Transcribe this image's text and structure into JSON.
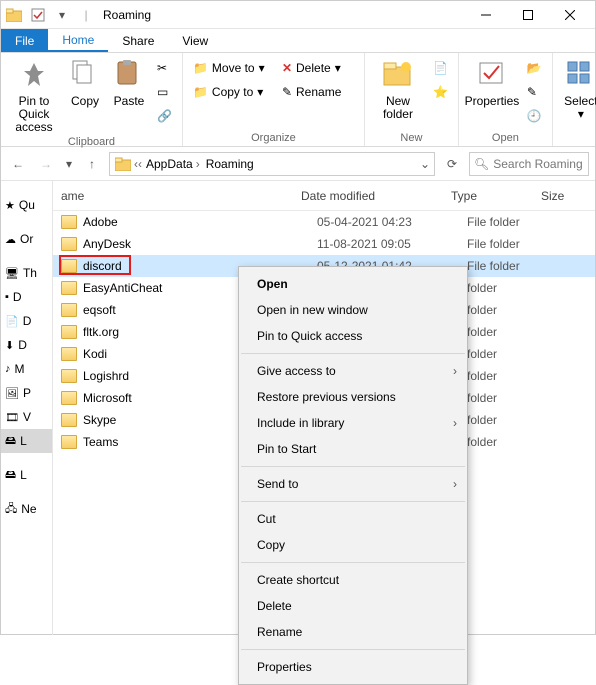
{
  "window": {
    "title": "Roaming"
  },
  "tabs": {
    "file": "File",
    "home": "Home",
    "share": "Share",
    "view": "View"
  },
  "ribbon": {
    "clipboard": {
      "label": "Clipboard",
      "pin": "Pin to Quick access",
      "copy": "Copy",
      "paste": "Paste"
    },
    "organize": {
      "label": "Organize",
      "moveto": "Move to",
      "copyto": "Copy to",
      "delete": "Delete",
      "rename": "Rename"
    },
    "new": {
      "label": "New",
      "newfolder": "New folder"
    },
    "open": {
      "label": "Open",
      "properties": "Properties"
    },
    "select": {
      "label": "Select"
    }
  },
  "address": {
    "crumbs": [
      "AppData",
      "Roaming"
    ],
    "search_placeholder": "Search Roaming"
  },
  "columns": {
    "name": "ame",
    "date": "Date modified",
    "type": "Type",
    "size": "Size"
  },
  "nav": [
    {
      "label": "Qu",
      "icon": "star"
    },
    {
      "label": "Or",
      "icon": "cloud"
    },
    {
      "label": "Th",
      "icon": "pc"
    },
    {
      "label": "D",
      "icon": "square"
    },
    {
      "label": "D",
      "icon": "doc"
    },
    {
      "label": "D",
      "icon": "down"
    },
    {
      "label": "M",
      "icon": "music"
    },
    {
      "label": "P",
      "icon": "pic"
    },
    {
      "label": "V",
      "icon": "vid"
    },
    {
      "label": "L",
      "icon": "disk",
      "sel": true
    },
    {
      "label": "L",
      "icon": "disk"
    },
    {
      "label": "Ne",
      "icon": "net"
    }
  ],
  "rows": [
    {
      "name": "Adobe",
      "date": "05-04-2021 04:23",
      "type": "File folder"
    },
    {
      "name": "AnyDesk",
      "date": "11-08-2021 09:05",
      "type": "File folder"
    },
    {
      "name": "discord",
      "date": "05-12-2021 01:42",
      "type": "File folder",
      "sel": true,
      "highlight": true
    },
    {
      "name": "EasyAntiCheat",
      "date": "",
      "type": "folder"
    },
    {
      "name": "eqsoft",
      "date": "",
      "type": "folder"
    },
    {
      "name": "fltk.org",
      "date": "",
      "type": "folder"
    },
    {
      "name": "Kodi",
      "date": "",
      "type": "folder"
    },
    {
      "name": "Logishrd",
      "date": "",
      "type": "folder"
    },
    {
      "name": "Microsoft",
      "date": "",
      "type": "folder"
    },
    {
      "name": "Skype",
      "date": "",
      "type": "folder"
    },
    {
      "name": "Teams",
      "date": "",
      "type": "folder"
    }
  ],
  "context": [
    {
      "label": "Open",
      "bold": true
    },
    {
      "label": "Open in new window"
    },
    {
      "label": "Pin to Quick access"
    },
    {
      "sep": true
    },
    {
      "label": "Give access to",
      "sub": true
    },
    {
      "label": "Restore previous versions"
    },
    {
      "label": "Include in library",
      "sub": true
    },
    {
      "label": "Pin to Start"
    },
    {
      "sep": true
    },
    {
      "label": "Send to",
      "sub": true
    },
    {
      "sep": true
    },
    {
      "label": "Cut"
    },
    {
      "label": "Copy"
    },
    {
      "sep": true
    },
    {
      "label": "Create shortcut"
    },
    {
      "label": "Delete",
      "highlight": true
    },
    {
      "label": "Rename"
    },
    {
      "sep": true
    },
    {
      "label": "Properties"
    }
  ]
}
